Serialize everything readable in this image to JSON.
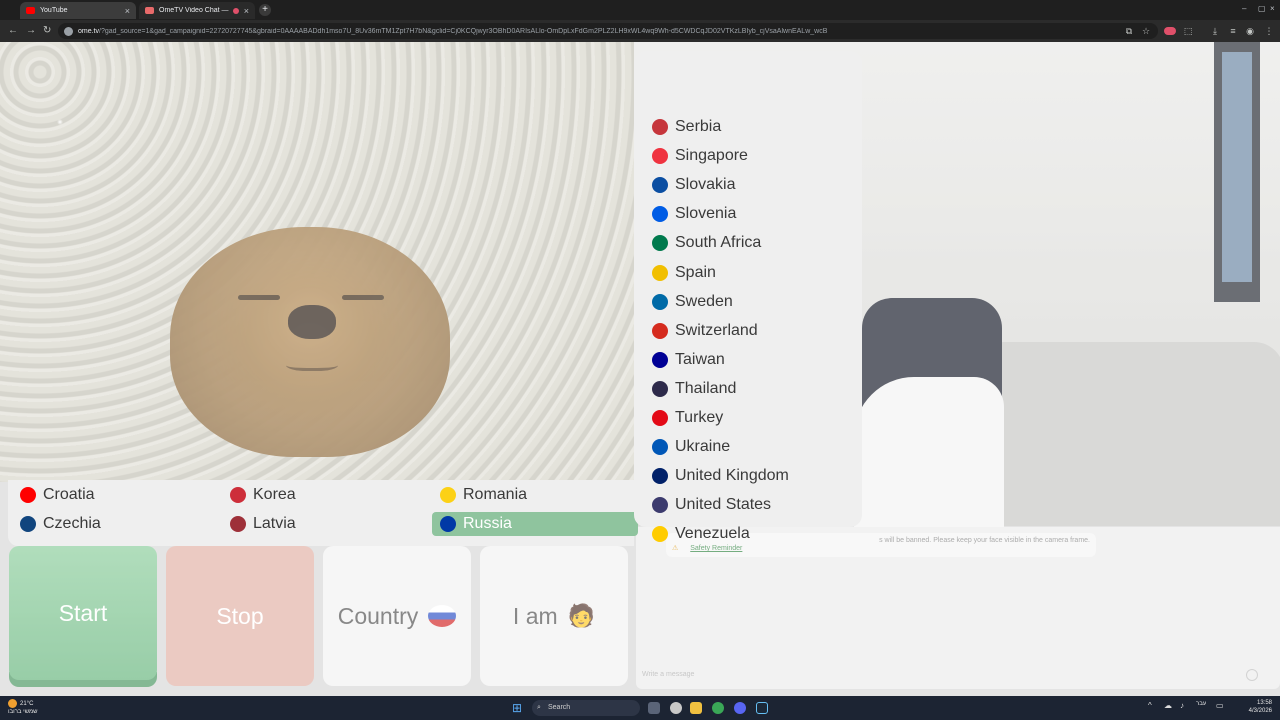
{
  "browser": {
    "tabs": [
      {
        "label": "YouTube"
      },
      {
        "label": "OmeTV Video Chat — Omegle"
      }
    ],
    "url_host": "ome.tv",
    "url_rest": "/?gad_source=1&gad_campaignid=22720727745&gbraid=0AAAABADdh1mso7U_8Uv36mTM1Zpt7H7bN&gclid=Cj0KCQjwyr3OBhD0ARIsALlo-OmDpLxFdGm2PLZ2LH9xWL4wq9Wh-d5CWDCqJD02VTKzLBIyb_cjVsaAlwnEALw_wcB"
  },
  "countries_column": [
    {
      "name": "Serbia",
      "flag": "#c6363c"
    },
    {
      "name": "Singapore",
      "flag": "#ef3340"
    },
    {
      "name": "Slovakia",
      "flag": "#0b4ea2"
    },
    {
      "name": "Slovenia",
      "flag": "#005ce5"
    },
    {
      "name": "South Africa",
      "flag": "#007a4d"
    },
    {
      "name": "Spain",
      "flag": "#f1bf00"
    },
    {
      "name": "Sweden",
      "flag": "#006aa7"
    },
    {
      "name": "Switzerland",
      "flag": "#d52b1e"
    },
    {
      "name": "Taiwan",
      "flag": "#000095"
    },
    {
      "name": "Thailand",
      "flag": "#2d2a4a"
    },
    {
      "name": "Turkey",
      "flag": "#e30a17"
    },
    {
      "name": "Ukraine",
      "flag": "#0057b7"
    },
    {
      "name": "United Kingdom",
      "flag": "#012169"
    },
    {
      "name": "United States",
      "flag": "#3c3b6e"
    },
    {
      "name": "Venezuela",
      "flag": "#ffcc00"
    }
  ],
  "countries_grid": [
    {
      "name": "Croatia",
      "flag": "#ff0000"
    },
    {
      "name": "Czechia",
      "flag": "#11457e"
    },
    {
      "name": "Korea",
      "flag": "#cd2e3a"
    },
    {
      "name": "Latvia",
      "flag": "#9e3039"
    },
    {
      "name": "Romania",
      "flag": "#fcd116"
    },
    {
      "name": "Russia",
      "flag": "#0039a6",
      "selected": true
    }
  ],
  "chat": {
    "system_message": "s will be banned. Please keep your face visible in the camera frame.",
    "safety_reminder": "Safety Reminder",
    "input_placeholder": "Write a message"
  },
  "controls": {
    "start": "Start",
    "stop": "Stop",
    "country": "Country",
    "iam": "I am",
    "iam_emoji": "🧑"
  },
  "taskbar": {
    "temperature": "21°C",
    "weather_desc": "שמשי ברובו",
    "search": "Search",
    "tray_lang": "עבר",
    "time": "13:58",
    "date": "4/3/2026"
  }
}
